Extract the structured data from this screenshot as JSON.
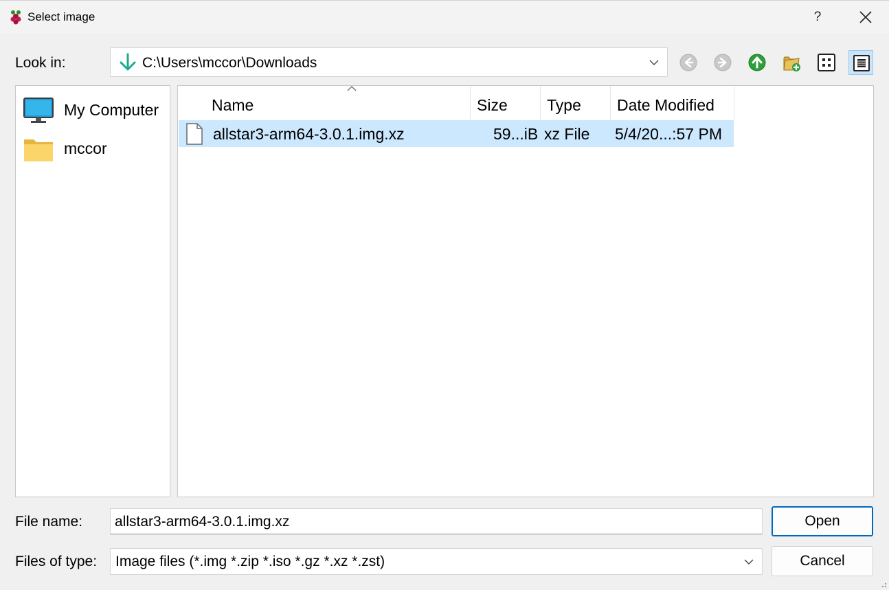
{
  "window": {
    "title": "Select image",
    "help_label": "?"
  },
  "lookin": {
    "label": "Look in:",
    "path": "C:\\Users\\mccor\\Downloads"
  },
  "sidebar": {
    "items": [
      {
        "label": "My Computer",
        "icon": "computer-icon"
      },
      {
        "label": "mccor",
        "icon": "folder-icon"
      }
    ]
  },
  "files": {
    "columns": [
      "Name",
      "Size",
      "Type",
      "Date Modified"
    ],
    "rows": [
      {
        "name": "allstar3-arm64-3.0.1.img.xz",
        "size": "59...iB",
        "type": "xz File",
        "modified": "5/4/20...:57 PM"
      }
    ]
  },
  "filename": {
    "label": "File name:",
    "value": "allstar3-arm64-3.0.1.img.xz"
  },
  "filetype": {
    "label": "Files of type:",
    "value": "Image files (*.img *.zip *.iso *.gz *.xz *.zst)"
  },
  "buttons": {
    "open": "Open",
    "cancel": "Cancel"
  },
  "colors": {
    "selection": "#cce8ff",
    "accent": "#0067c0",
    "up_arrow_green": "#2e9e3a",
    "down_arrow_teal": "#1aab8a"
  }
}
